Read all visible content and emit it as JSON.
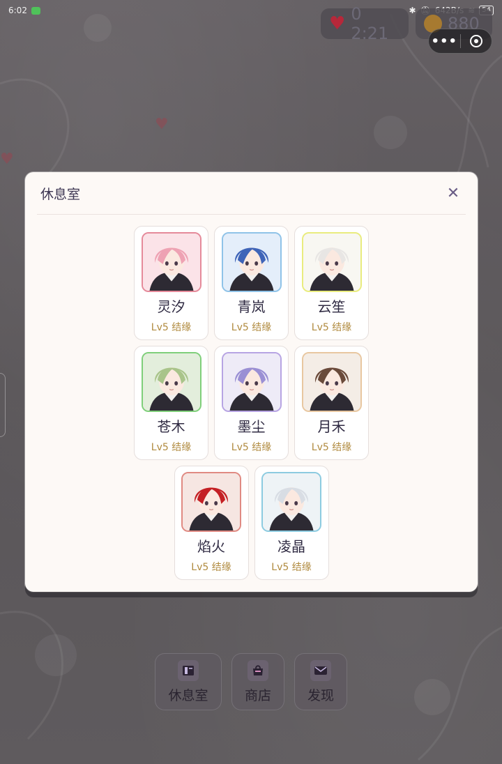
{
  "status_bar": {
    "time": "6:02",
    "speed": "642B/s",
    "battery": "54"
  },
  "hud": {
    "lives": "0 2:21",
    "coins": "880"
  },
  "modal": {
    "title": "休息室",
    "close_icon": "close-icon",
    "characters": [
      {
        "name": "灵汐",
        "meta": "Lv5 结缘",
        "frame_color": "#e58a9a",
        "hair": "#eea2b3",
        "bg": "#fbe3e8"
      },
      {
        "name": "青岚",
        "meta": "Lv5 结缘",
        "frame_color": "#8fc3e8",
        "hair": "#3f64b8",
        "bg": "#e4eefa"
      },
      {
        "name": "云笙",
        "meta": "Lv5 结缘",
        "frame_color": "#e9ec7e",
        "hair": "#e8e6e4",
        "bg": "#f8f7f2"
      },
      {
        "name": "苍木",
        "meta": "Lv5 结缘",
        "frame_color": "#7fcf7a",
        "hair": "#a9c48a",
        "bg": "#e3eedc"
      },
      {
        "name": "墨尘",
        "meta": "Lv5 结缘",
        "frame_color": "#b7a4e3",
        "hair": "#9a8fd4",
        "bg": "#eeebf7"
      },
      {
        "name": "月禾",
        "meta": "Lv5 结缘",
        "frame_color": "#e8c7a0",
        "hair": "#6a4a3a",
        "bg": "#f4ede6"
      },
      {
        "name": "焰火",
        "meta": "Lv5 结缘",
        "frame_color": "#e08a82",
        "hair": "#c42024",
        "bg": "#f6e6e2"
      },
      {
        "name": "凌晶",
        "meta": "Lv5 结缘",
        "frame_color": "#8ccbe0",
        "hair": "#d8dde4",
        "bg": "#eef3f6"
      }
    ]
  },
  "bottom_nav": [
    {
      "label": "休息室",
      "icon": "book-icon"
    },
    {
      "label": "商店",
      "icon": "shop-icon"
    },
    {
      "label": "发现",
      "icon": "mail-icon"
    }
  ]
}
